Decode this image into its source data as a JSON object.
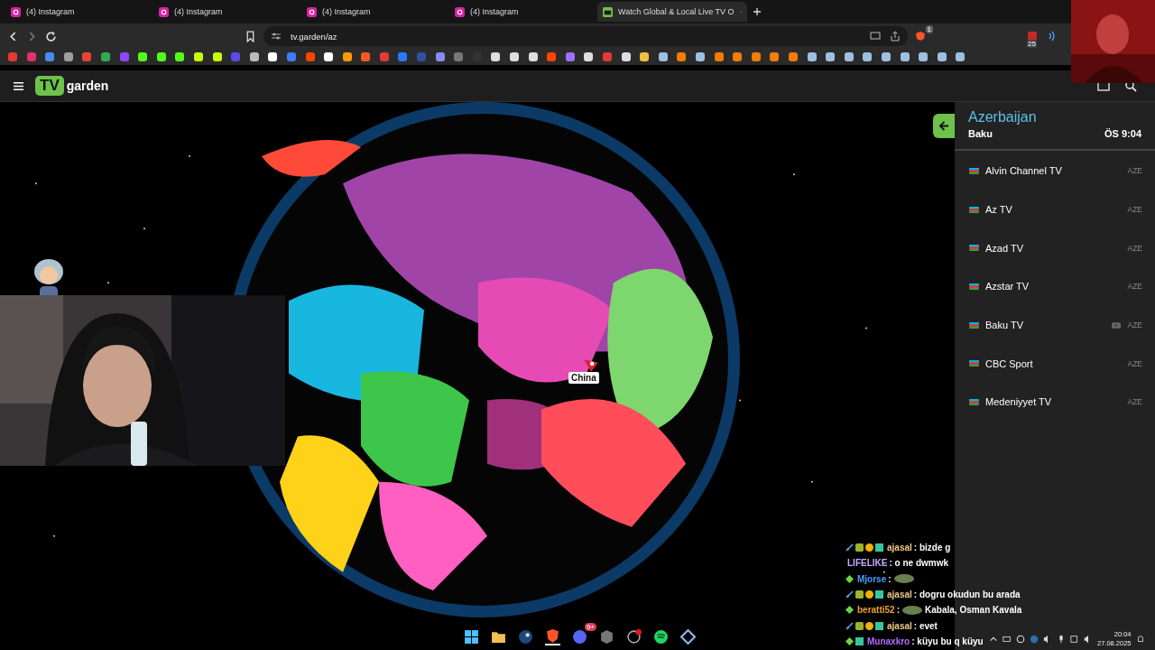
{
  "browser": {
    "tabs": [
      {
        "title": "(4) Instagram",
        "kind": "instagram",
        "selected": false
      },
      {
        "title": "(4) Instagram",
        "kind": "instagram",
        "selected": false
      },
      {
        "title": "(4) Instagram",
        "kind": "instagram",
        "selected": false
      },
      {
        "title": "(4) Instagram",
        "kind": "instagram",
        "selected": false
      },
      {
        "title": "Watch Global & Local Live TV O",
        "kind": "tv",
        "selected": true
      }
    ],
    "address": "tv.garden/az",
    "shield_count": "1",
    "extension_badge": "25"
  },
  "site": {
    "logo_mark": "TV",
    "logo_word": "garden"
  },
  "globe": {
    "kind": "picture",
    "label": "China"
  },
  "panel": {
    "country": "Azerbaijan",
    "city": "Baku",
    "time": "ÖS 9:04",
    "channels": [
      {
        "name": "Alvin Channel TV",
        "code": "AZE",
        "youtube": false
      },
      {
        "name": "Az TV",
        "code": "AZE",
        "youtube": false
      },
      {
        "name": "Azad TV",
        "code": "AZE",
        "youtube": false
      },
      {
        "name": "Azstar TV",
        "code": "AZE",
        "youtube": false
      },
      {
        "name": "Baku TV",
        "code": "AZE",
        "youtube": true
      },
      {
        "name": "CBC Sport",
        "code": "AZE",
        "youtube": false
      },
      {
        "name": "Medeniyyet TV",
        "code": "AZE",
        "youtube": false
      }
    ]
  },
  "chat": [
    {
      "kind": "mod",
      "user": "ajasal",
      "color": "#f0c987",
      "message": ": bizde g"
    },
    {
      "kind": "none",
      "user": "LIFELIKE",
      "color": "#c9a8ff",
      "message": ": o ne dwmwk"
    },
    {
      "kind": "vip",
      "user": "Mjorse",
      "color": "#4a9cff",
      "message": ":",
      "emote": true
    },
    {
      "kind": "mod",
      "user": "ajasal",
      "color": "#f0c987",
      "message": ": dogru okudun bu arada"
    },
    {
      "kind": "vip",
      "user": "beratti52",
      "color": "#f0a030",
      "message": ":",
      "emote": true,
      "after": "Kabala, Osman Kavala"
    },
    {
      "kind": "mod",
      "user": "ajasal",
      "color": "#f0c987",
      "message": ": evet"
    },
    {
      "kind": "vipgem",
      "user": "Munaxkro",
      "color": "#b26cff",
      "message": ": küyu bu q küyu"
    }
  ],
  "taskbar": {
    "time": "20:04",
    "date": "27.08.2025",
    "discord_badge": "9+"
  }
}
